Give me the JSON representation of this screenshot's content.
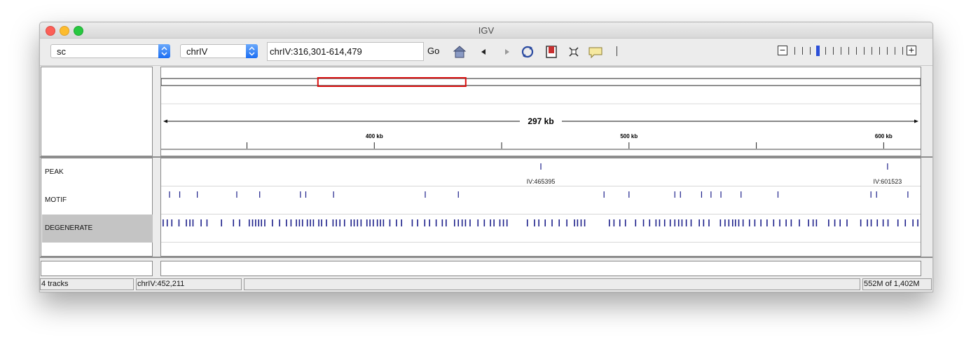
{
  "window": {
    "title": "IGV"
  },
  "toolbar": {
    "genome": "sc",
    "chromosome": "chrIV",
    "locus": "chrIV:316,301-614,479",
    "go_label": "Go",
    "icons": [
      "home-icon",
      "back-icon",
      "forward-icon",
      "refresh-icon",
      "roi-icon",
      "resize-icon",
      "popup-icon"
    ],
    "zoom_levels": 15,
    "zoom_selected": 3
  },
  "ruler": {
    "span_label": "297 kb",
    "view_start": 316301,
    "view_end": 614479,
    "chromosome_length": 1531933,
    "ticks": [
      {
        "pos": 350000,
        "label": ""
      },
      {
        "pos": 400000,
        "label": "400 kb"
      },
      {
        "pos": 450000,
        "label": ""
      },
      {
        "pos": 500000,
        "label": "500 kb"
      },
      {
        "pos": 550000,
        "label": ""
      },
      {
        "pos": 600000,
        "label": "600 kb"
      }
    ]
  },
  "tracks": [
    {
      "name": "PEAK",
      "selected": false
    },
    {
      "name": "MOTIF",
      "selected": false
    },
    {
      "name": "DEGENERATE",
      "selected": true
    }
  ],
  "peaks": [
    {
      "pos": 465395,
      "label": "IV:465395"
    },
    {
      "pos": 601523,
      "label": "IV:601523"
    }
  ],
  "motif_features": [
    319600,
    323600,
    330500,
    346000,
    355000,
    371000,
    373100,
    384000,
    420000,
    433000,
    490200,
    500000,
    518000,
    520200,
    528500,
    532200,
    536100,
    544000,
    558500,
    595000,
    597200,
    609500
  ],
  "degenerate_features": [
    317100,
    318700,
    320500,
    323300,
    326200,
    327600,
    328800,
    332000,
    334300,
    340000,
    344700,
    347100,
    350900,
    352200,
    353400,
    354600,
    355700,
    357000,
    360000,
    362800,
    365500,
    367300,
    369400,
    370600,
    371800,
    373700,
    374900,
    376100,
    378200,
    379300,
    381200,
    383800,
    385100,
    386500,
    388300,
    390900,
    392100,
    393400,
    394800,
    397100,
    398300,
    399600,
    401200,
    402400,
    403600,
    406100,
    408700,
    410700,
    414900,
    417000,
    419800,
    421700,
    424300,
    426700,
    428200,
    431500,
    433000,
    434500,
    435800,
    437600,
    440700,
    443200,
    445600,
    447000,
    449300,
    450700,
    452100,
    460100,
    462900,
    464600,
    467100,
    469800,
    472600,
    475600,
    478600,
    479800,
    481200,
    482600,
    492300,
    494100,
    496400,
    498600,
    502600,
    505700,
    508100,
    510600,
    512000,
    514000,
    516200,
    518000,
    519500,
    520800,
    522500,
    524400,
    527600,
    529300,
    531400,
    535900,
    537700,
    539200,
    540700,
    541800,
    543100,
    544800,
    547300,
    549400,
    551800,
    554200,
    556800,
    559200,
    561700,
    563700,
    566900,
    570500,
    572300,
    573600,
    578400,
    580800,
    582900,
    585600,
    591000,
    593600,
    595100,
    597500,
    599800,
    601700,
    605600,
    608500,
    611500,
    613400
  ],
  "status": {
    "tracks": "4 tracks",
    "position": "chrIV:452,211",
    "message": "",
    "memory": "552M of 1,402M"
  },
  "colors": {
    "feature": "#1c1f8a",
    "roi_box": "#d9100f",
    "selected_track_bg": "#c4c4c4"
  }
}
